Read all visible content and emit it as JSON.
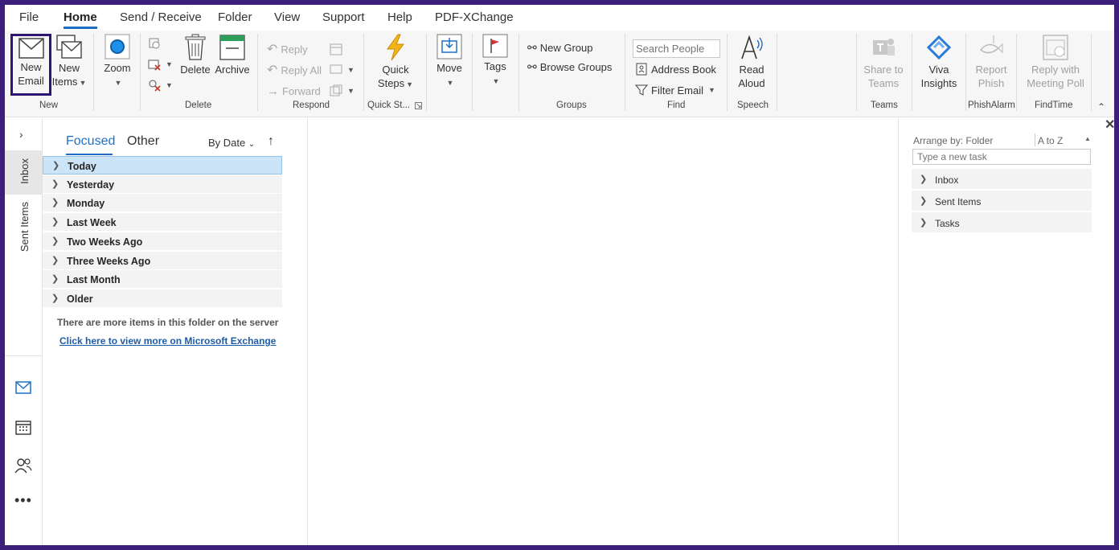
{
  "tabs": [
    "File",
    "Home",
    "Send / Receive",
    "Folder",
    "View",
    "Support",
    "Help",
    "PDF-XChange"
  ],
  "ribbon": {
    "new": {
      "new_email": [
        "New",
        "Email"
      ],
      "new_items": [
        "New",
        "Items"
      ],
      "label": "New"
    },
    "zoom": "Zoom",
    "delete": {
      "delete": "Delete",
      "archive": "Archive",
      "label": "Delete"
    },
    "respond": {
      "reply": "Reply",
      "reply_all": "Reply All",
      "forward": "Forward",
      "label": "Respond"
    },
    "quick_steps": {
      "button": [
        "Quick",
        "Steps"
      ],
      "label": "Quick St..."
    },
    "move": "Move",
    "tags": "Tags",
    "groups": {
      "new_group": "New Group",
      "browse_groups": "Browse Groups",
      "label": "Groups"
    },
    "find": {
      "search_placeholder": "Search People",
      "address_book": "Address Book",
      "filter_email": "Filter Email",
      "label": "Find"
    },
    "speech": {
      "read_aloud": [
        "Read",
        "Aloud"
      ],
      "label": "Speech"
    },
    "teams": {
      "share": [
        "Share to",
        "Teams"
      ],
      "label": "Teams"
    },
    "viva": [
      "Viva",
      "Insights"
    ],
    "phish": {
      "report": [
        "Report",
        "Phish"
      ],
      "label": "PhishAlarm"
    },
    "findtime": {
      "reply_poll": [
        "Reply with",
        "Meeting Poll"
      ],
      "label": "FindTime"
    }
  },
  "nav": {
    "inbox": "Inbox",
    "sent": "Sent Items"
  },
  "list": {
    "focused": "Focused",
    "other": "Other",
    "sort": "By Date",
    "groups": [
      "Today",
      "Yesterday",
      "Monday",
      "Last Week",
      "Two Weeks Ago",
      "Three Weeks Ago",
      "Last Month",
      "Older"
    ],
    "more_items": "There are more items in this folder on the server",
    "exchange_link": "Click here to view more on Microsoft Exchange"
  },
  "todo": {
    "arrange": "Arrange by: Folder",
    "order": "A to Z",
    "task_placeholder": "Type a new task",
    "folders": [
      "Inbox",
      "Sent Items",
      "Tasks"
    ]
  },
  "colors": {
    "accent": "#1f6fc5",
    "frame": "#3b1f7a",
    "highlight": "#2c1672",
    "selected": "#cce4f7"
  }
}
